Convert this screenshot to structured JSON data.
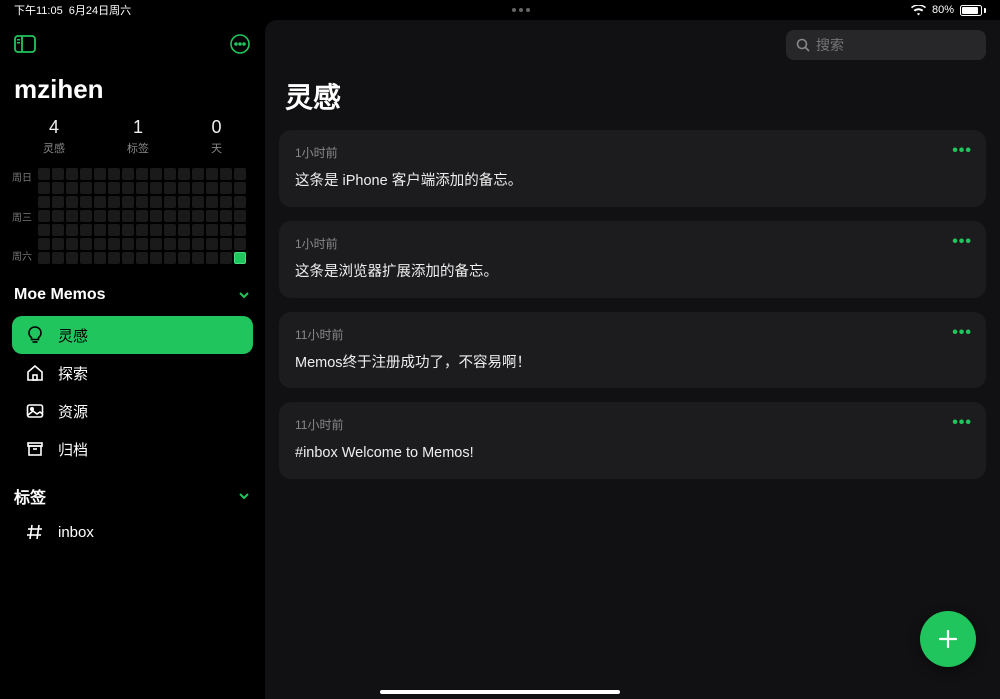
{
  "status": {
    "time": "下午11:05",
    "date": "6月24日周六",
    "battery_pct": "80%"
  },
  "sidebar": {
    "username": "mzihen",
    "stats": [
      {
        "num": "4",
        "label": "灵感"
      },
      {
        "num": "1",
        "label": "标签"
      },
      {
        "num": "0",
        "label": "天"
      }
    ],
    "heatmap_days": [
      "周日",
      "周三",
      "周六"
    ],
    "nav_header": "Moe Memos",
    "nav": [
      {
        "label": "灵感",
        "active": true
      },
      {
        "label": "探索",
        "active": false
      },
      {
        "label": "资源",
        "active": false
      },
      {
        "label": "归档",
        "active": false
      }
    ],
    "tags_header": "标签",
    "tags": [
      {
        "label": "inbox"
      }
    ]
  },
  "main": {
    "search_placeholder": "搜索",
    "title": "灵感",
    "memos": [
      {
        "time": "1小时前",
        "content": "这条是 iPhone 客户端添加的备忘。"
      },
      {
        "time": "1小时前",
        "content": "这条是浏览器扩展添加的备忘。"
      },
      {
        "time": "11小时前",
        "content": "Memos终于注册成功了，不容易啊！"
      },
      {
        "time": "11小时前",
        "content": "#inbox Welcome to Memos!"
      }
    ]
  },
  "accent": "#21c55d"
}
